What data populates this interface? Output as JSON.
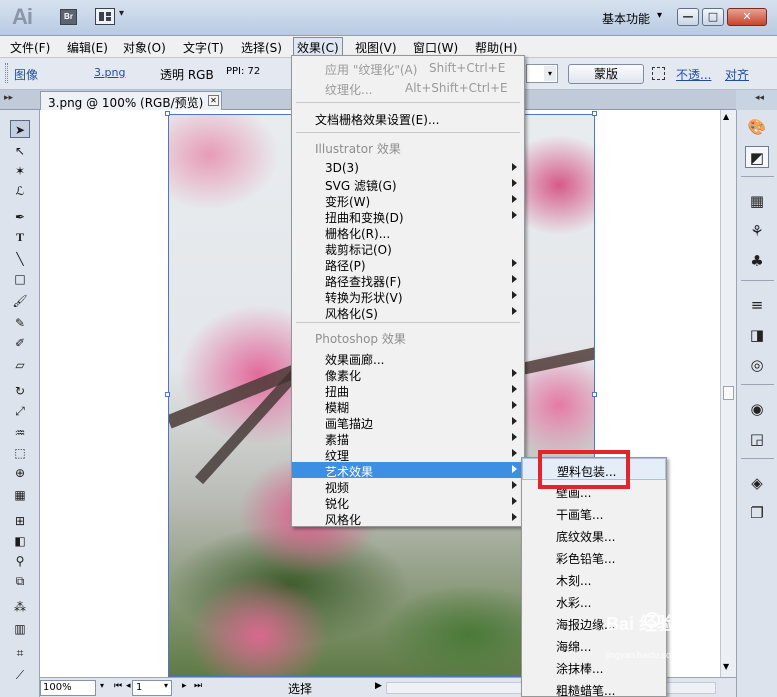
{
  "titlebar": {
    "app_logo": "Ai",
    "bridge_label": "Br",
    "workspace_label": "基本功能",
    "caret": "▾",
    "minimize": "—",
    "maximize": "□",
    "close": "✕"
  },
  "menubar": {
    "items": [
      "文件(F)",
      "编辑(E)",
      "对象(O)",
      "文字(T)",
      "选择(S)",
      "效果(C)",
      "视图(V)",
      "窗口(W)",
      "帮助(H)"
    ]
  },
  "controlbar": {
    "image_label": "图像",
    "filename": "3.png",
    "mode": "透明 RGB",
    "ppi": "PPI: 72",
    "mask_button": "蒙版",
    "opacity_link": "不透...",
    "align_link": "对齐"
  },
  "document_tab": {
    "label": "3.png @ 100% (RGB/预览)",
    "close": "✕"
  },
  "statusbar": {
    "zoom": "100%",
    "page": "1",
    "status_text": "选择"
  },
  "effects_menu": {
    "apply_last": {
      "label": "应用 \"纹理化\"(A)",
      "shortcut": "Shift+Ctrl+E"
    },
    "last_effect": {
      "label": "纹理化...",
      "shortcut": "Alt+Shift+Ctrl+E"
    },
    "raster_settings": "文档栅格效果设置(E)...",
    "illustrator_section": "Illustrator 效果",
    "illustrator_items": [
      "3D(3)",
      "SVG 滤镜(G)",
      "变形(W)",
      "扭曲和变换(D)",
      "栅格化(R)...",
      "裁剪标记(O)",
      "路径(P)",
      "路径查找器(F)",
      "转换为形状(V)",
      "风格化(S)"
    ],
    "photoshop_section": "Photoshop 效果",
    "photoshop_items": [
      "效果画廊...",
      "像素化",
      "扭曲",
      "模糊",
      "画笔描边",
      "素描",
      "纹理",
      "艺术效果",
      "视频",
      "锐化",
      "风格化"
    ],
    "highlighted": "艺术效果"
  },
  "artistic_menu": {
    "items": [
      "塑料包装...",
      "壁画...",
      "干画笔...",
      "底纹效果...",
      "彩色铅笔...",
      "木刻...",
      "水彩...",
      "海报边缘...",
      "海绵...",
      "涂抹棒...",
      "粗糙蜡笔..."
    ],
    "hovered": "塑料包装..."
  },
  "watermark": {
    "brand": "Bai 经验",
    "url": "jingyan.baidu.com"
  },
  "colors": {
    "highlight": "#3c8fe2",
    "annotation_box": "#e2242b",
    "link": "#1e4ea3"
  }
}
